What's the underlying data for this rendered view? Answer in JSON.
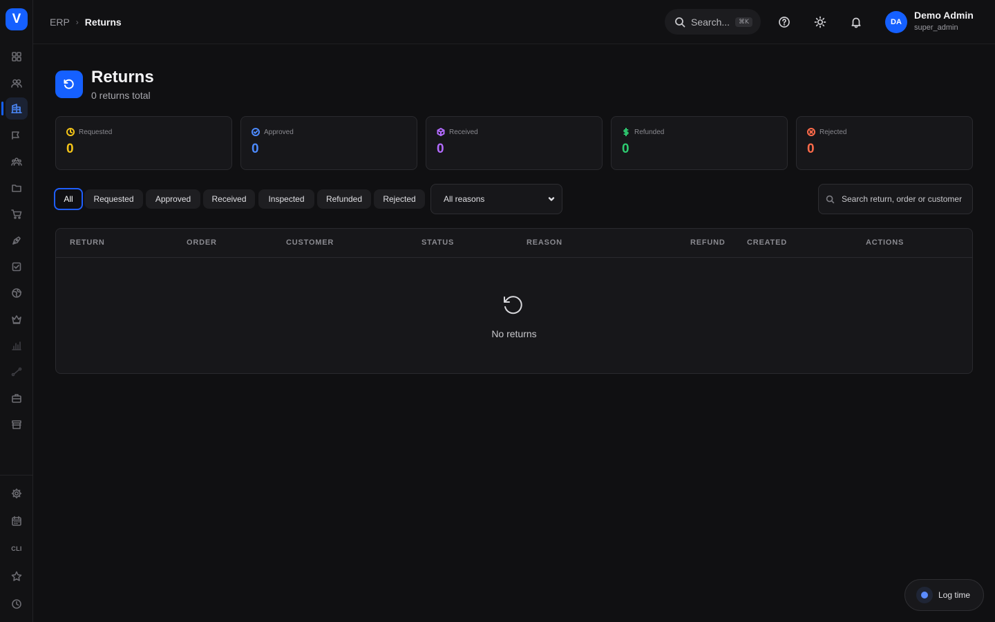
{
  "app": {
    "logo_letter": "V"
  },
  "sidebar": {
    "items": [
      {
        "name": "dashboard-grid-icon"
      },
      {
        "name": "contacts-icon"
      },
      {
        "name": "building-icon"
      },
      {
        "name": "megaphone-icon"
      },
      {
        "name": "team-icon"
      },
      {
        "name": "folder-icon"
      },
      {
        "name": "cart-icon"
      },
      {
        "name": "pen-icon"
      },
      {
        "name": "checkbox-icon"
      },
      {
        "name": "globe-icon"
      },
      {
        "name": "crown-icon"
      },
      {
        "name": "bar-chart-icon"
      },
      {
        "name": "workflow-icon"
      },
      {
        "name": "briefcase-icon"
      },
      {
        "name": "store-icon"
      }
    ],
    "bottom_items": [
      {
        "name": "settings-icon"
      },
      {
        "name": "calendar-icon"
      },
      {
        "name": "cli-icon",
        "label": "CLI"
      },
      {
        "name": "star-icon"
      },
      {
        "name": "history-icon"
      }
    ]
  },
  "header": {
    "breadcrumb_root": "ERP",
    "breadcrumb_current": "Returns",
    "search_label": "Search...",
    "search_shortcut": "⌘K",
    "user": {
      "initials": "DA",
      "name": "Demo Admin",
      "role": "super_admin"
    }
  },
  "page": {
    "title": "Returns",
    "subtitle": "0 returns total"
  },
  "stats": [
    {
      "label": "Requested",
      "value": "0",
      "color": "#f5c518",
      "icon": "clock-icon"
    },
    {
      "label": "Approved",
      "value": "0",
      "color": "#4d8bff",
      "icon": "check-circle-icon"
    },
    {
      "label": "Received",
      "value": "0",
      "color": "#b36bff",
      "icon": "package-icon"
    },
    {
      "label": "Refunded",
      "value": "0",
      "color": "#2ecc71",
      "icon": "dollar-icon"
    },
    {
      "label": "Rejected",
      "value": "0",
      "color": "#ff6b4a",
      "icon": "x-circle-icon"
    }
  ],
  "filters": {
    "tabs": [
      "All",
      "Requested",
      "Approved",
      "Received",
      "Inspected",
      "Refunded",
      "Rejected"
    ],
    "active_tab": "All",
    "reason_selected": "All reasons",
    "search_placeholder": "Search return, order or customer"
  },
  "table": {
    "columns": [
      "Return",
      "Order",
      "Customer",
      "Status",
      "Reason",
      "Refund",
      "Created",
      "Actions"
    ],
    "empty_text": "No returns"
  },
  "log_time": {
    "label": "Log time"
  },
  "colors": {
    "accent": "#1560ff",
    "background": "#101012",
    "card": "#17171a"
  }
}
